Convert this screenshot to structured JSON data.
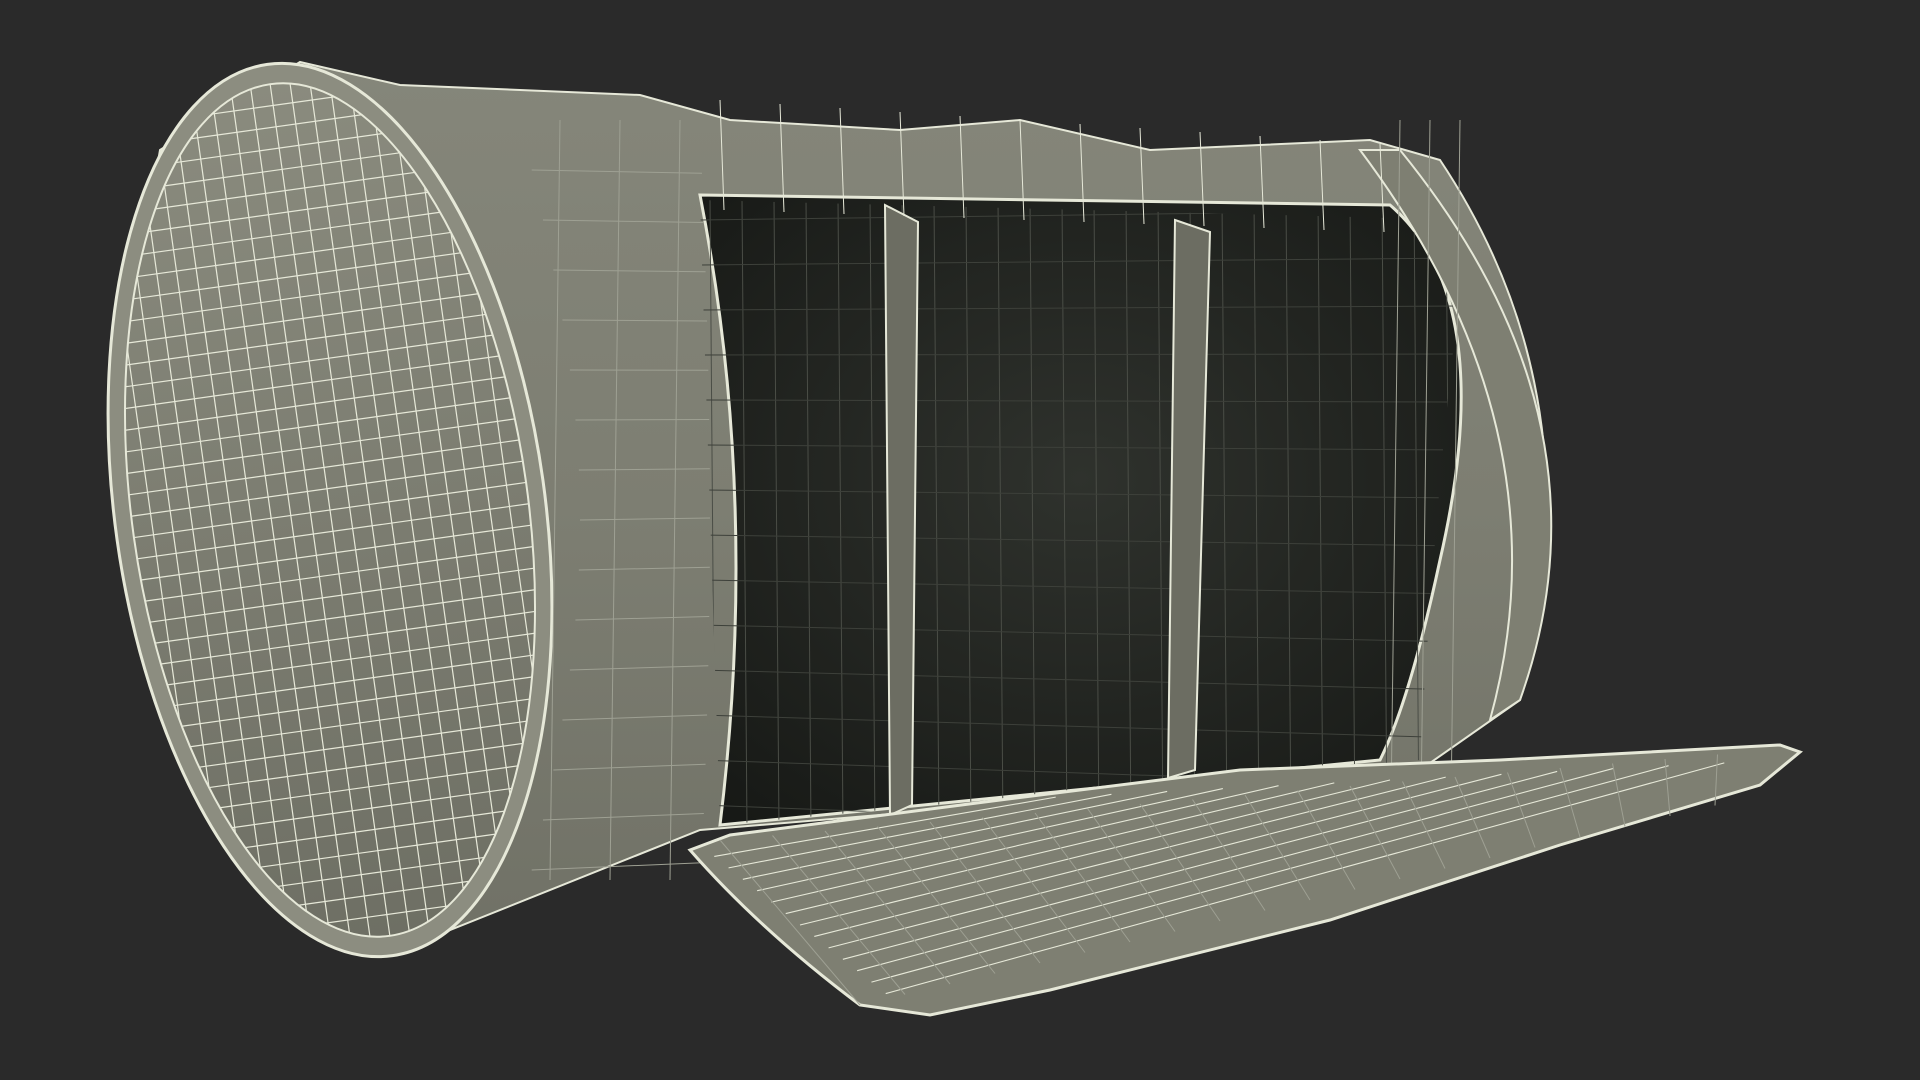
{
  "scene": {
    "subject": "wireframe-render-of-oil-barrel-shelf",
    "colors": {
      "background": "#2a2a2a",
      "surface": "#7e7f72",
      "surface_light": "#8c8d80",
      "surface_dark": "#6c6d62",
      "interior": "#1e211d",
      "interior_mid": "#2c2f2a",
      "wire": "#e6e8d8",
      "wire_dim": "#9ea093"
    }
  }
}
